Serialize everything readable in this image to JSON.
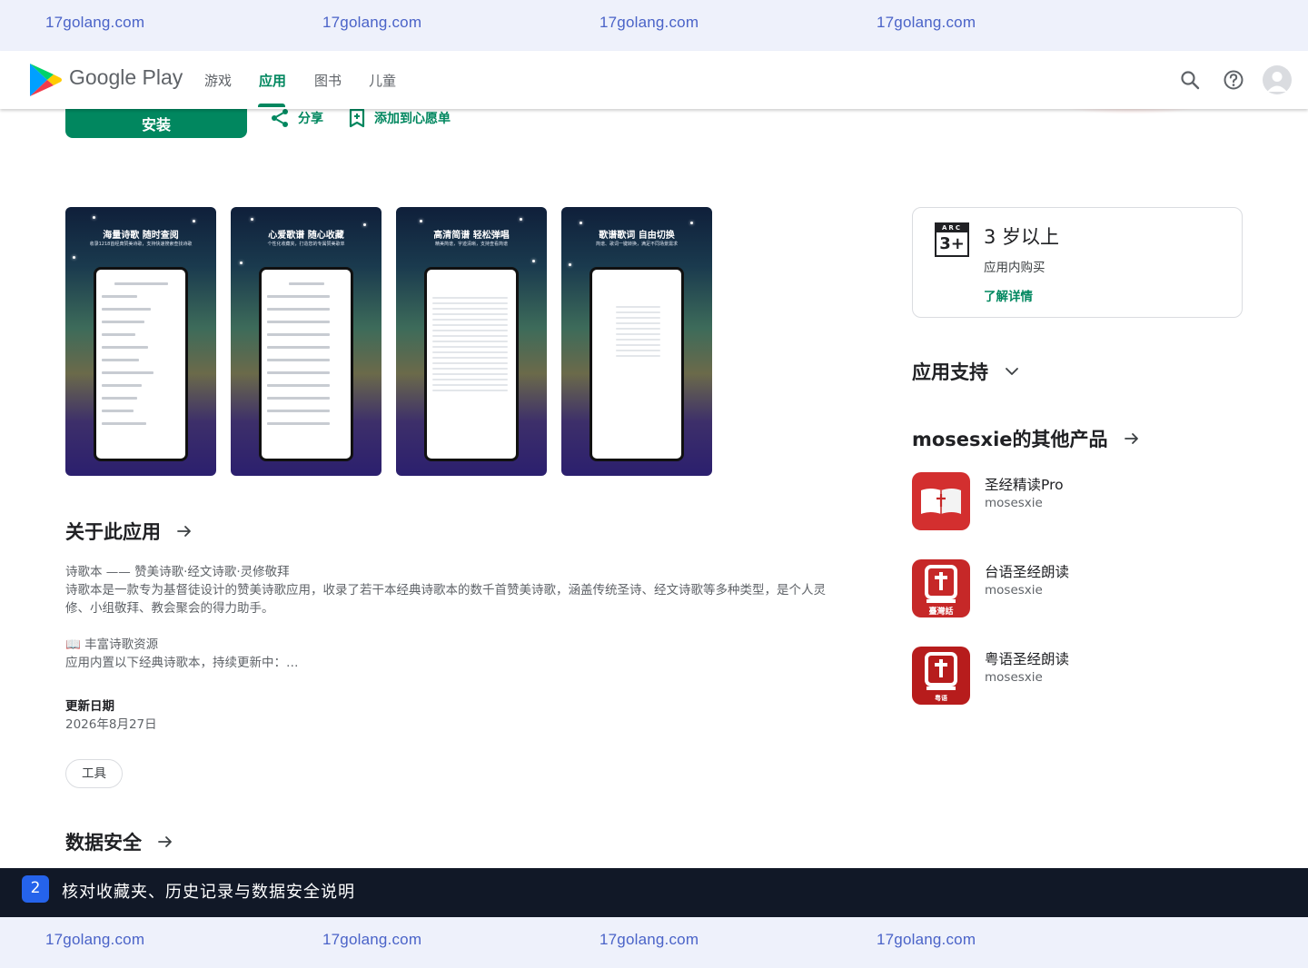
{
  "watermarks": {
    "top": [
      "17golang.com",
      "17golang.com",
      "17golang.com",
      "17golang.com"
    ],
    "bottom": [
      "17golang.com",
      "17golang.com",
      "17golang.com",
      "17golang.com"
    ]
  },
  "header": {
    "brand": "Google Play",
    "nav": [
      "游戏",
      "应用",
      "图书",
      "儿童"
    ],
    "active_tab": "应用"
  },
  "actions": {
    "install": "安装",
    "share": "分享",
    "wishlist": "添加到心愿单"
  },
  "screenshots": [
    {
      "title": "海量诗歌 随时查阅",
      "subtitle": "收录1218首经典赞美诗歌，支持快速搜索查找诗歌"
    },
    {
      "title": "心爱歌谱 随心收藏",
      "subtitle": "个性化收藏夹，打造您的专属赞美歌单"
    },
    {
      "title": "高清简谱 轻松弹唱",
      "subtitle": "精美简谱，字迹清晰，支持查看简谱"
    },
    {
      "title": "歌谱歌词 自由切换",
      "subtitle": "简谱、歌词一键转换，满足不同场景需求"
    }
  ],
  "about": {
    "title": "关于此应用",
    "line1": "诗歌本 —— 赞美诗歌·经文诗歌·灵修敬拜",
    "line2": "诗歌本是一款专为基督徒设计的赞美诗歌应用，收录了若干本经典诗歌本的数千首赞美诗歌，涵盖传统圣诗、经文诗歌等多种类型，是个人灵修、小组敬拜、教会聚会的得力助手。",
    "line3": "📖 丰富诗歌资源",
    "line4": "应用内置以下经典诗歌本，持续更新中：…",
    "updated_label": "更新日期",
    "updated_value": "2026年8月27日",
    "tag": "工具"
  },
  "data_safety": {
    "title": "数据安全"
  },
  "rating": {
    "arc_label": "ARC",
    "arc_age": "3+",
    "age": "3 岁以上",
    "iap": "应用内购买",
    "link": "了解详情"
  },
  "support": {
    "title": "应用支持"
  },
  "more_by": {
    "title": "mosesxie的其他产品",
    "apps": [
      {
        "name": "圣经精读Pro",
        "dev": "mosesxie"
      },
      {
        "name": "台语圣经朗读",
        "dev": "mosesxie",
        "badge": "臺灣話"
      },
      {
        "name": "粤语圣经朗读",
        "dev": "mosesxie",
        "badge": "粤语"
      }
    ]
  },
  "caption": {
    "number": "2",
    "text": "核对收藏夹、历史记录与数据安全说明"
  },
  "colors": {
    "accent": "#01875f",
    "caption_bg": "#111827",
    "badge_blue": "#2563eb",
    "app_icon_red": "#c62828"
  }
}
